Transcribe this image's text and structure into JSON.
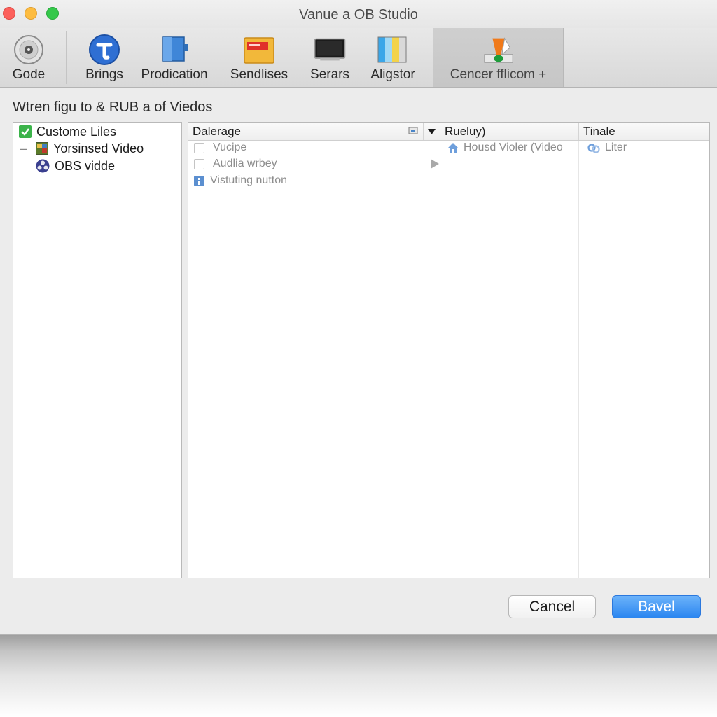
{
  "window": {
    "title": "Vanue a OB Studio"
  },
  "toolbar": {
    "items": [
      {
        "label": "Gode",
        "icon": "disc-icon"
      },
      {
        "label": "Brings",
        "icon": "blue-t-globe-icon"
      },
      {
        "label": "Prodication",
        "icon": "blue-panel-icon"
      },
      {
        "label": "Sendlises",
        "icon": "folder-icon"
      },
      {
        "label": "Serars",
        "icon": "monitor-icon"
      },
      {
        "label": "Aligstor",
        "icon": "color-bars-icon"
      },
      {
        "label": "Cencer fflicom +",
        "icon": "vlc-cone-icon"
      }
    ]
  },
  "main": {
    "heading": "Wtren figu to & RUB a of Viedos"
  },
  "sidebar": {
    "items": [
      {
        "label": "Custome Liles",
        "icon": "green-check-icon"
      },
      {
        "prefix": "–",
        "label": "Yorsinsed Video",
        "icon": "image-icon"
      },
      {
        "label": "OBS vidde",
        "icon": "obs-icon"
      }
    ]
  },
  "table": {
    "columns": [
      "Dalerage",
      "Rueluy)",
      "Tinale"
    ],
    "col1_rows": [
      "Vucipe",
      "Audlia wrbey",
      "Vistuting nutton"
    ],
    "col2_rows": [
      "Housd Violer (Video"
    ],
    "col3_rows": [
      "Liter"
    ]
  },
  "buttons": {
    "cancel": "Cancel",
    "primary": "Bavel"
  },
  "colors": {
    "accent": "#2b86f0",
    "window_bg": "#ececec",
    "close": "#fc605b",
    "minimize": "#fdbc40",
    "zoom": "#34c84a"
  }
}
